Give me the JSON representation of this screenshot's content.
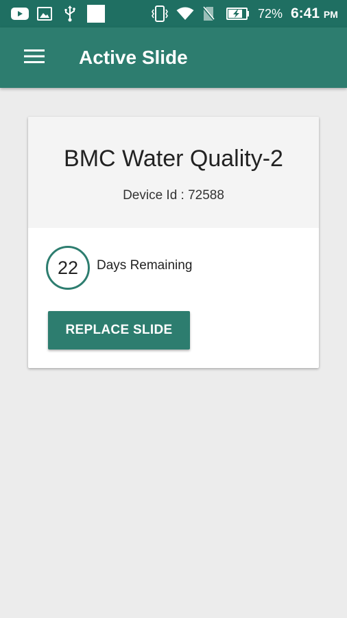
{
  "status_bar": {
    "icons": [
      "youtube-icon",
      "image-icon",
      "usb-icon",
      "blank-notification-icon",
      "vibrate-icon",
      "wifi-icon",
      "no-sim-icon",
      "battery-charging-icon"
    ],
    "battery_percent": "72%",
    "time": "6:41",
    "ampm": "PM"
  },
  "app_bar": {
    "menu_icon": "menu-icon",
    "title": "Active Slide"
  },
  "card": {
    "device_name": "BMC Water Quality-2",
    "device_id": "Device Id : 72588",
    "days_remaining": "22",
    "days_label": "Days Remaining",
    "replace_button": "REPLACE SLIDE"
  },
  "colors": {
    "status_bar": "#1f6f62",
    "app_bar": "#2d7d6f",
    "accent": "#2d7d6f",
    "background": "#ececec",
    "card_header": "#f4f4f4"
  }
}
